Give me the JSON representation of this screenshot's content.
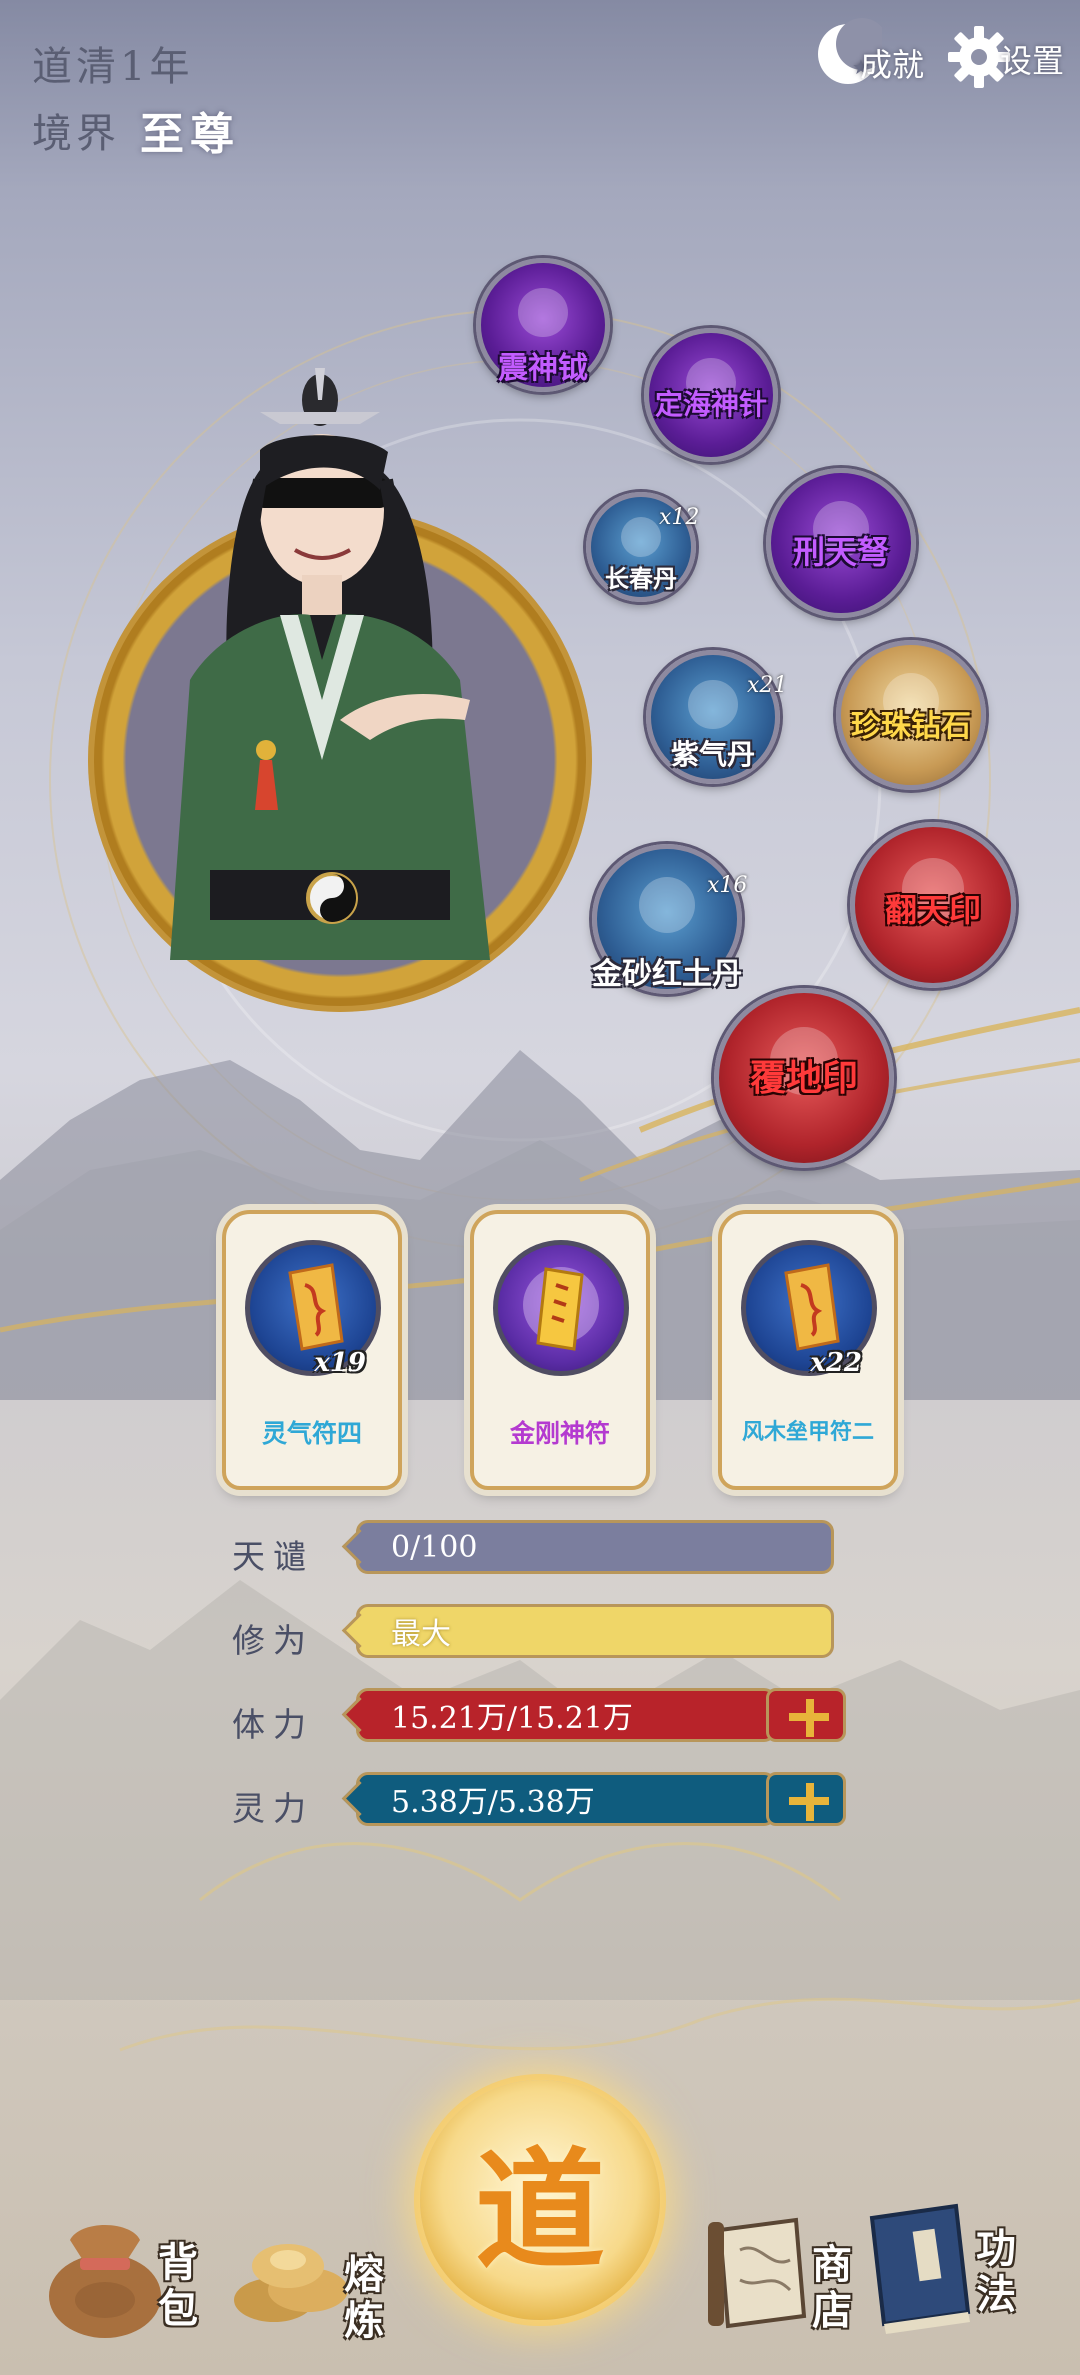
{
  "header": {
    "daoqing_label": "道清",
    "daoqing_value": "1年",
    "realm_label": "境界",
    "realm_value": "至尊",
    "achievements_label": "成就",
    "settings_label": "设置"
  },
  "orbs": [
    {
      "name": "震神钺",
      "style": "purple"
    },
    {
      "name": "定海神针",
      "style": "purple"
    },
    {
      "name": "长春丹",
      "count": "x12",
      "style": "blue"
    },
    {
      "name": "刑天弩",
      "style": "purple"
    },
    {
      "name": "紫气丹",
      "count": "x21",
      "style": "blue"
    },
    {
      "name": "珍珠钻石",
      "style": "gold"
    },
    {
      "name": "金砂红土丹",
      "count": "x16",
      "style": "blue"
    },
    {
      "name": "翻天印",
      "style": "red"
    },
    {
      "name": "覆地印",
      "style": "red"
    }
  ],
  "cards": [
    {
      "label": "灵气符四",
      "count": "x19",
      "color": "#2fa8d6"
    },
    {
      "label": "金刚神符",
      "count": "",
      "color": "#b43ad0"
    },
    {
      "label": "风木垒甲符二",
      "count": "x22",
      "color": "#2fa8d6"
    }
  ],
  "stats": [
    {
      "label": "天谴",
      "value": "0/100",
      "color": "#7b7e9e",
      "fill": 0.0
    },
    {
      "label": "修为",
      "value": "最大",
      "color": "#efd668",
      "fill": 1.0
    },
    {
      "label": "体力",
      "value": "15.21万/15.21万",
      "color": "#b8232a",
      "fill": 1.0
    },
    {
      "label": "灵力",
      "value": "5.38万/5.38万",
      "color": "#0f5c7e",
      "fill": 1.0
    }
  ],
  "nav": {
    "backpack": "背包",
    "smelt": "熔炼",
    "dao_center": "道",
    "shop": "商店",
    "skills": "功法"
  }
}
